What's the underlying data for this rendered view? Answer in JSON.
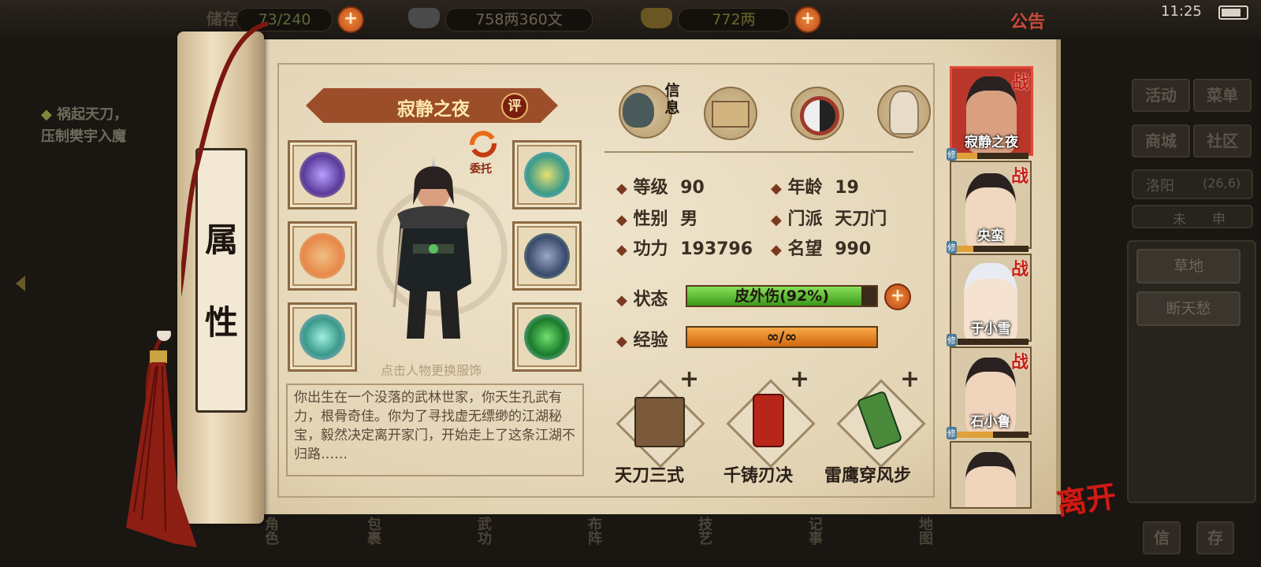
{
  "topbar": {
    "storage": {
      "label": "储存",
      "value": "73/240"
    },
    "silver": "758两360文",
    "gold": "772两",
    "notice": "公告",
    "clock": "11:25"
  },
  "quest": {
    "line1": "祸起天刀，",
    "line2": "压制樊宇入魔"
  },
  "right_menu": {
    "buttons": [
      "活动",
      "菜单",
      "商城",
      "社区"
    ],
    "location": "洛阳",
    "coords": "(26,6)",
    "time_chars": [
      "未",
      "申"
    ],
    "list": [
      "草地",
      "断天愁"
    ],
    "bottom_buttons": [
      "信",
      "存"
    ]
  },
  "bottom_nav": [
    "角色",
    "包裹",
    "武功",
    "布阵",
    "技艺",
    "记事",
    "地图"
  ],
  "scroll_title": [
    "属",
    "性"
  ],
  "character": {
    "name": "寂静之夜",
    "rate_label": "评",
    "entrust_label": "委托",
    "change_outfit_hint": "点击人物更换服饰",
    "bio": "你出生在一个没落的武林世家，你天生孔武有力，根骨奇佳。你为了寻找虚无缥缈的江湖秘宝，毅然决定离开家门，开始走上了这条江湖不归路……"
  },
  "tabs": {
    "info_label": "信息",
    "items": [
      "info-tab",
      "scroll-tab",
      "bagua-tab",
      "body-tab"
    ]
  },
  "stats": {
    "level_label": "等级",
    "level": "90",
    "age_label": "年龄",
    "age": "19",
    "gender_label": "性别",
    "gender": "男",
    "sect_label": "门派",
    "sect": "天刀门",
    "power_label": "功力",
    "power": "193796",
    "fame_label": "名望",
    "fame": "990",
    "status_label": "状态",
    "status_text": "皮外伤(92%)",
    "status_pct": 0.92,
    "exp_label": "经验",
    "exp_text": "∞/∞",
    "exp_pct": 1.0
  },
  "skills": [
    {
      "name": "天刀三式"
    },
    {
      "name": "千铸刃决"
    },
    {
      "name": "雷鹰穿风步"
    }
  ],
  "roster": [
    {
      "name": "寂静之夜",
      "fight": "战",
      "active": true,
      "xp": 0.35
    },
    {
      "name": "央蛮",
      "fight": "战",
      "active": false,
      "xp": 0.3
    },
    {
      "name": "于小雪",
      "fight": "战",
      "active": false,
      "xp": 0.1
    },
    {
      "name": "石小鲁",
      "fight": "战",
      "active": false,
      "xp": 0.55
    },
    {
      "name": "",
      "fight": "",
      "active": false,
      "xp": 0
    }
  ],
  "roster_cultivate_label": "修",
  "leave_label": "离开",
  "colors": {
    "hp_green": "#5cbf2a",
    "exp_orange": "#e8841c",
    "accent_red": "#c71e14"
  }
}
